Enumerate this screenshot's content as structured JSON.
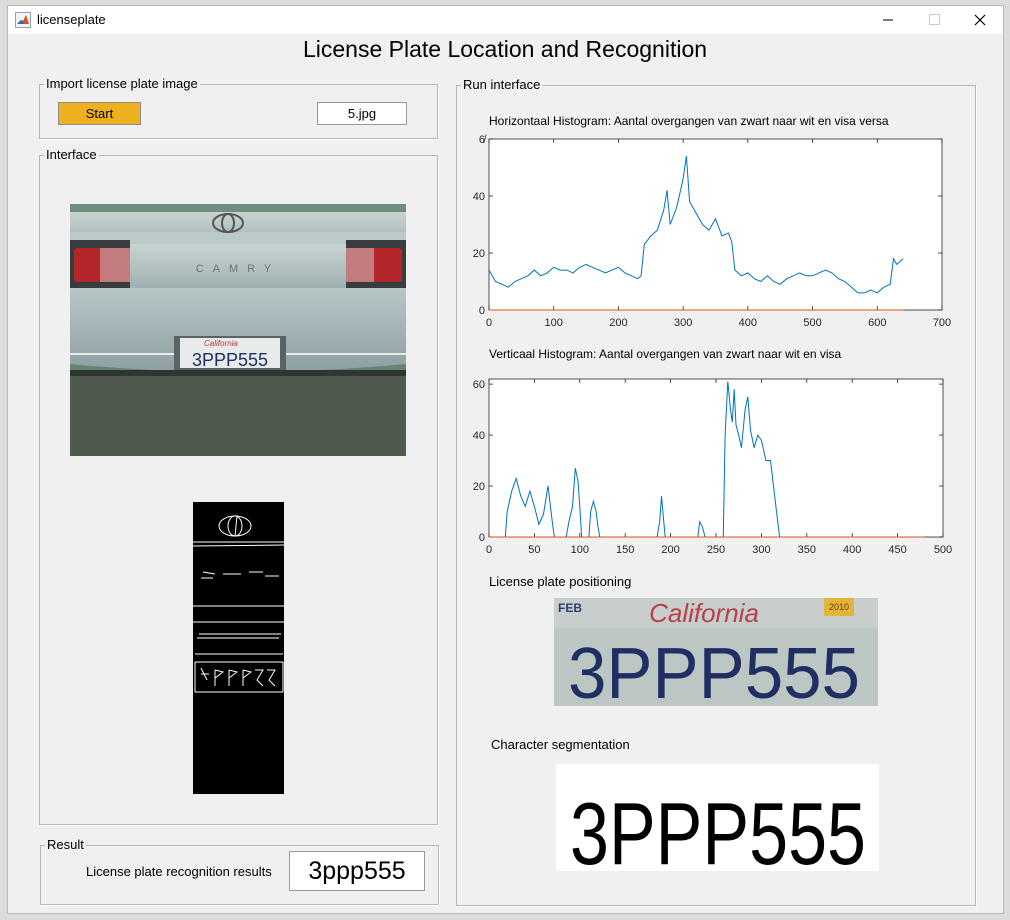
{
  "window": {
    "title": "licenseplate"
  },
  "heading": "License Plate Location and Recognition",
  "import_panel": {
    "title": "Import license plate image",
    "start_label": "Start",
    "filename": "5.jpg"
  },
  "interface_panel": {
    "title": "Interface"
  },
  "result_panel": {
    "title": "Result",
    "label": "License plate recognition results",
    "value": "3ppp555"
  },
  "run_panel": {
    "title": "Run interface",
    "positioning_label": "License plate positioning",
    "segmentation_label": "Character segmentation",
    "plate_text": "3PPP555",
    "plate_state": "California",
    "plate_month": "FEB",
    "plate_year": "2010",
    "car_plate_text": "3PPP555",
    "car_badge": "CAMRY"
  },
  "chart_data": [
    {
      "type": "line",
      "title": "Horizontaal Histogram: Aantal overgangen van zwart naar wit en visa versa",
      "xlim": [
        0,
        700
      ],
      "ylim": [
        0,
        60
      ],
      "xticks": [
        0,
        100,
        200,
        300,
        400,
        500,
        600,
        700
      ],
      "yticks": [
        0,
        20,
        40,
        "6̸"
      ],
      "series": [
        {
          "color": "#0072bd",
          "points": [
            [
              0,
              14
            ],
            [
              10,
              10
            ],
            [
              20,
              9
            ],
            [
              30,
              8
            ],
            [
              40,
              10
            ],
            [
              50,
              11
            ],
            [
              60,
              12
            ],
            [
              70,
              14
            ],
            [
              80,
              12
            ],
            [
              90,
              13
            ],
            [
              100,
              15
            ],
            [
              110,
              14
            ],
            [
              120,
              14
            ],
            [
              130,
              13
            ],
            [
              140,
              15
            ],
            [
              150,
              16
            ],
            [
              160,
              15
            ],
            [
              170,
              14
            ],
            [
              180,
              13
            ],
            [
              190,
              14
            ],
            [
              200,
              15
            ],
            [
              210,
              13
            ],
            [
              220,
              12
            ],
            [
              230,
              11
            ],
            [
              235,
              12
            ],
            [
              240,
              23
            ],
            [
              250,
              26
            ],
            [
              260,
              28
            ],
            [
              270,
              35
            ],
            [
              275,
              42
            ],
            [
              280,
              30
            ],
            [
              290,
              36
            ],
            [
              300,
              46
            ],
            [
              305,
              54
            ],
            [
              310,
              38
            ],
            [
              320,
              34
            ],
            [
              330,
              30
            ],
            [
              340,
              28
            ],
            [
              350,
              32
            ],
            [
              360,
              26
            ],
            [
              370,
              27
            ],
            [
              375,
              24
            ],
            [
              380,
              14
            ],
            [
              390,
              12
            ],
            [
              400,
              13
            ],
            [
              410,
              11
            ],
            [
              420,
              10
            ],
            [
              430,
              12
            ],
            [
              440,
              10
            ],
            [
              450,
              9
            ],
            [
              460,
              11
            ],
            [
              470,
              12
            ],
            [
              480,
              13
            ],
            [
              490,
              12
            ],
            [
              500,
              12
            ],
            [
              510,
              13
            ],
            [
              520,
              14
            ],
            [
              530,
              13
            ],
            [
              540,
              11
            ],
            [
              550,
              10
            ],
            [
              560,
              8
            ],
            [
              570,
              6
            ],
            [
              580,
              6
            ],
            [
              590,
              7
            ],
            [
              600,
              6
            ],
            [
              610,
              8
            ],
            [
              620,
              9
            ],
            [
              625,
              18
            ],
            [
              630,
              16
            ],
            [
              640,
              18
            ]
          ]
        },
        {
          "color": "#d95319",
          "points": [
            [
              0,
              0
            ],
            [
              640,
              0
            ]
          ]
        }
      ]
    },
    {
      "type": "line",
      "title": "Verticaal Histogram: Aantal overgangen van zwart naar wit en visa",
      "xlim": [
        0,
        500
      ],
      "ylim": [
        0,
        62
      ],
      "xticks": [
        0,
        50,
        100,
        150,
        200,
        250,
        300,
        350,
        400,
        450,
        500
      ],
      "yticks": [
        0,
        20,
        40,
        60
      ],
      "series": [
        {
          "color": "#0072bd",
          "points": [
            [
              0,
              0
            ],
            [
              18,
              0
            ],
            [
              20,
              10
            ],
            [
              25,
              18
            ],
            [
              30,
              23
            ],
            [
              35,
              16
            ],
            [
              40,
              12
            ],
            [
              45,
              18
            ],
            [
              50,
              12
            ],
            [
              55,
              5
            ],
            [
              60,
              9
            ],
            [
              65,
              20
            ],
            [
              70,
              5
            ],
            [
              72,
              0
            ],
            [
              85,
              0
            ],
            [
              88,
              6
            ],
            [
              92,
              12
            ],
            [
              95,
              27
            ],
            [
              98,
              22
            ],
            [
              100,
              12
            ],
            [
              102,
              0
            ],
            [
              110,
              0
            ],
            [
              112,
              10
            ],
            [
              115,
              14
            ],
            [
              118,
              10
            ],
            [
              120,
              4
            ],
            [
              122,
              0
            ],
            [
              185,
              0
            ],
            [
              188,
              6
            ],
            [
              190,
              16
            ],
            [
              192,
              8
            ],
            [
              194,
              0
            ],
            [
              230,
              0
            ],
            [
              232,
              6
            ],
            [
              235,
              4
            ],
            [
              238,
              0
            ],
            [
              258,
              0
            ],
            [
              260,
              40
            ],
            [
              263,
              61
            ],
            [
              266,
              50
            ],
            [
              268,
              45
            ],
            [
              270,
              58
            ],
            [
              272,
              44
            ],
            [
              275,
              40
            ],
            [
              278,
              35
            ],
            [
              282,
              50
            ],
            [
              285,
              55
            ],
            [
              288,
              42
            ],
            [
              292,
              35
            ],
            [
              296,
              40
            ],
            [
              300,
              38
            ],
            [
              305,
              30
            ],
            [
              310,
              30
            ],
            [
              315,
              15
            ],
            [
              318,
              6
            ],
            [
              320,
              0
            ],
            [
              480,
              0
            ]
          ]
        },
        {
          "color": "#d95319",
          "points": [
            [
              0,
              0
            ],
            [
              480,
              0
            ]
          ]
        }
      ]
    }
  ]
}
